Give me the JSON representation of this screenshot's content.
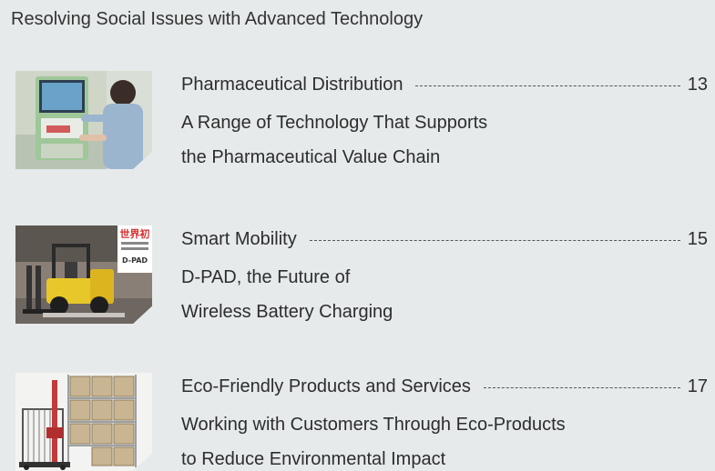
{
  "heading": "Resolving Social Issues with Advanced Technology",
  "entries": [
    {
      "title": "Pharmaceutical Distribution",
      "page": "13",
      "desc_line1": "A Range of Technology That Supports",
      "desc_line2": "the Pharmaceutical Value Chain",
      "image_icon": "pharmacy-terminal-photo"
    },
    {
      "title": "Smart Mobility",
      "page": "15",
      "desc_line1": "D-PAD, the Future of",
      "desc_line2": "Wireless Battery Charging",
      "image_icon": "forklift-photo",
      "sign_text": [
        "世界初",
        "D-PAD"
      ]
    },
    {
      "title": "Eco-Friendly Products and Services",
      "page": "17",
      "desc_line1": "Working with Customers Through Eco-Products",
      "desc_line2": "to Reduce Environmental Impact",
      "image_icon": "warehouse-racking-photo"
    }
  ]
}
